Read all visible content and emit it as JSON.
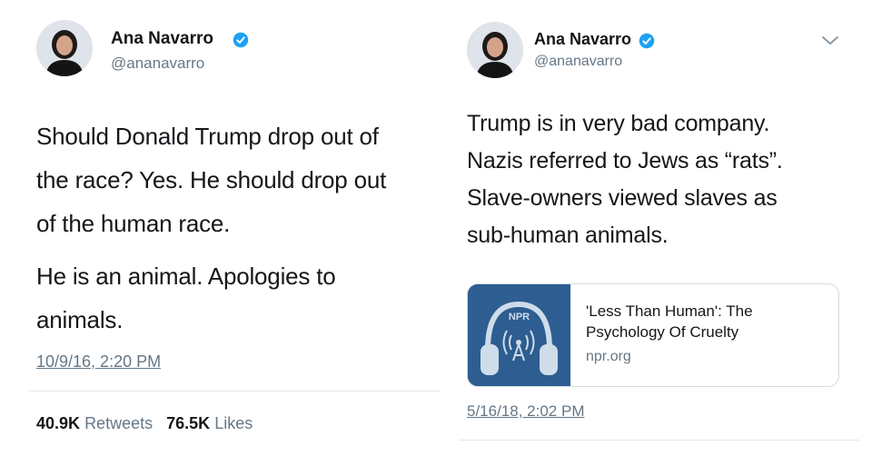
{
  "left_tweet": {
    "author_name": "Ana Navarro",
    "author_handle": "@ananavarro",
    "paragraphs": [
      [
        "Should Donald Trump drop out of",
        "the race? Yes. He should drop out",
        "of the human race."
      ],
      [
        "He is an animal. Apologies to",
        "animals."
      ]
    ],
    "timestamp": "10/9/16, 2:20 PM",
    "retweets_count": "40.9K",
    "retweets_label": "Retweets",
    "likes_count": "76.5K",
    "likes_label": "Likes"
  },
  "right_tweet": {
    "author_name": "Ana Navarro",
    "author_handle": "@ananavarro",
    "paragraph": [
      "Trump is in very bad company.",
      "Nazis referred to Jews as “rats”.",
      "Slave-owners viewed slaves as",
      "sub-human animals."
    ],
    "card": {
      "logo_text": "NPR",
      "title_lines": [
        "'Less Than Human': The",
        "Psychology Of Cruelty"
      ],
      "domain": "npr.org"
    },
    "timestamp": "5/16/18, 2:02 PM"
  },
  "icons": {
    "verified": "verified-badge-icon",
    "chevron": "chevron-down-icon",
    "headphones": "headphones-icon"
  },
  "colors": {
    "verified_blue": "#1da1f2",
    "secondary_text": "#657786",
    "npr_blue": "#2d5d91"
  }
}
